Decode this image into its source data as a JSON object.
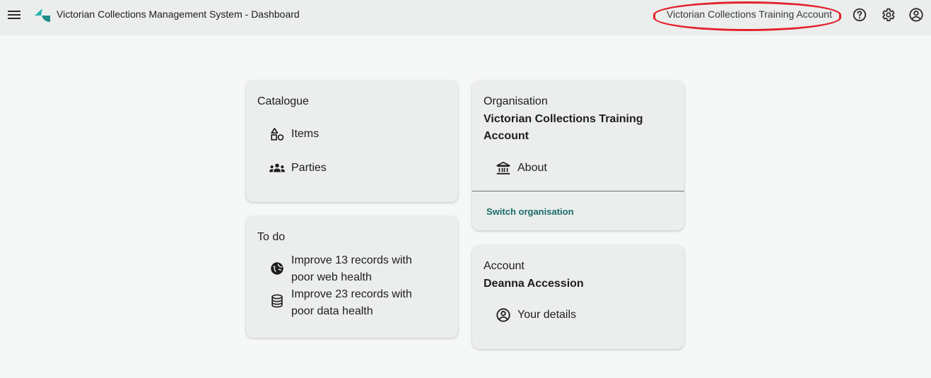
{
  "header": {
    "app_title": "Victorian Collections Management System - Dashboard",
    "account_name": "Victorian Collections Training Account",
    "icons": [
      "menu-icon",
      "logo-icon",
      "help-icon",
      "settings-icon",
      "account-circle-icon"
    ]
  },
  "catalogue": {
    "title": "Catalogue",
    "items": [
      {
        "label": "Items",
        "icon": "shapes-icon"
      },
      {
        "label": "Parties",
        "icon": "people-icon"
      }
    ]
  },
  "todo": {
    "title": "To do",
    "items": [
      {
        "label": "Improve 13 records with poor web health",
        "icon": "globe-icon"
      },
      {
        "label": "Improve 23 records with poor data health",
        "icon": "database-icon"
      }
    ]
  },
  "organisation": {
    "title": "Organisation",
    "name": "Victorian Collections Training Account",
    "about_label": "About",
    "switch_label": "Switch organisation"
  },
  "account": {
    "title": "Account",
    "name": "Deanna Accession",
    "details_label": "Your details"
  },
  "colors": {
    "background": "#f6f8f7",
    "card": "#ebeeed",
    "link": "#1a6b66",
    "highlight": "#e3202a",
    "logo_teal": "#2ab3b1"
  }
}
